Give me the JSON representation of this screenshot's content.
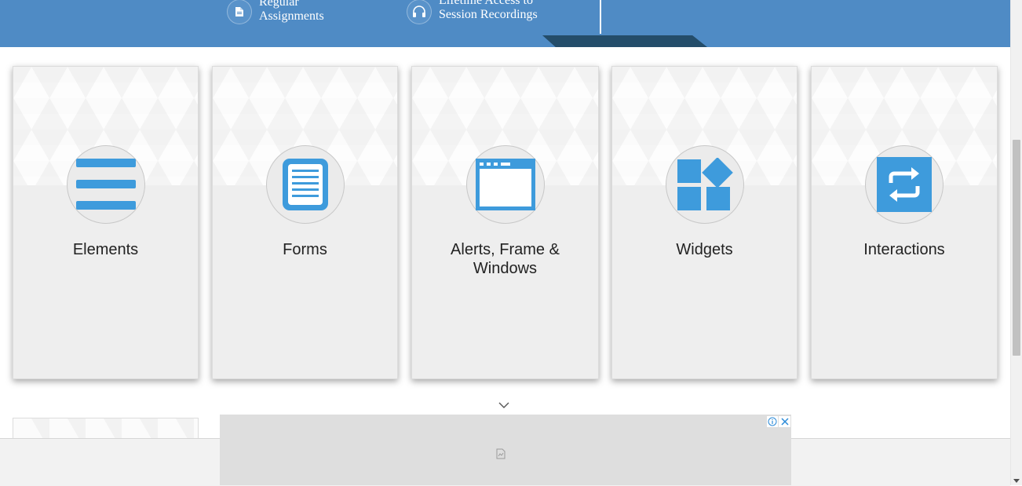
{
  "banner": {
    "features": [
      {
        "icon": "document-icon",
        "line1": "Regular",
        "line2": "Assignments"
      },
      {
        "icon": "headphones-icon",
        "line1": "Lifetime Access to",
        "line2": "Session Recordings"
      }
    ]
  },
  "cards": [
    {
      "label": "Elements",
      "icon": "hamburger-menu-icon"
    },
    {
      "label": "Forms",
      "icon": "form-document-icon"
    },
    {
      "label": "Alerts, Frame & Windows",
      "icon": "browser-window-icon"
    },
    {
      "label": "Widgets",
      "icon": "widgets-grid-icon"
    },
    {
      "label": "Interactions",
      "icon": "swap-arrows-icon"
    }
  ],
  "ad": {
    "info_icon": "info-icon",
    "close_icon": "close-icon",
    "placeholder_icon": "broken-image-icon"
  },
  "colors": {
    "banner": "#4f8bc5",
    "accent": "#3e9bdc",
    "dark_tab": "#25506e"
  }
}
